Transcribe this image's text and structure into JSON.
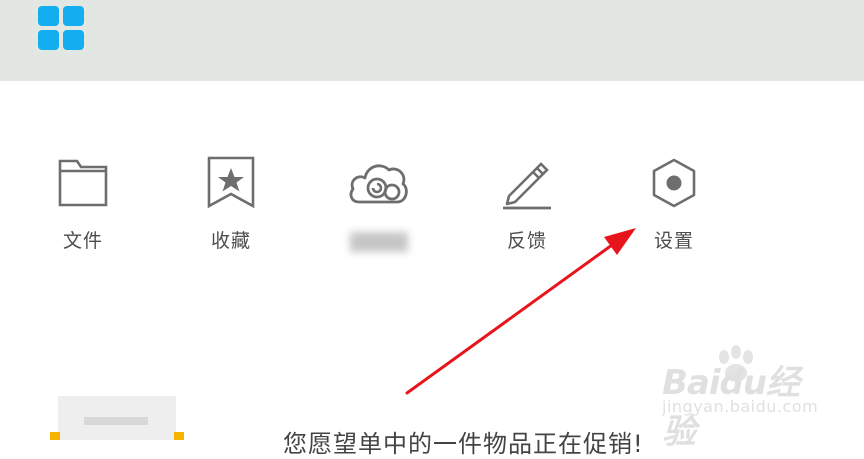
{
  "header": {
    "app_icon": "app-grid-icon",
    "accent_color": "#12aef0"
  },
  "menu": {
    "items": [
      {
        "label": "文件",
        "icon": "folder-icon"
      },
      {
        "label": "收藏",
        "icon": "bookmark-icon"
      },
      {
        "label": "",
        "icon": "cloud-icon"
      },
      {
        "label": "反馈",
        "icon": "edit-icon"
      },
      {
        "label": "设置",
        "icon": "settings-icon"
      }
    ]
  },
  "annotation": {
    "arrow_color": "#e8141c"
  },
  "bottom": {
    "text": "您愿望单中的一件物品正在促销!"
  },
  "watermark": {
    "brand": "Baidu经验",
    "url": "jingyan.baidu.com"
  }
}
